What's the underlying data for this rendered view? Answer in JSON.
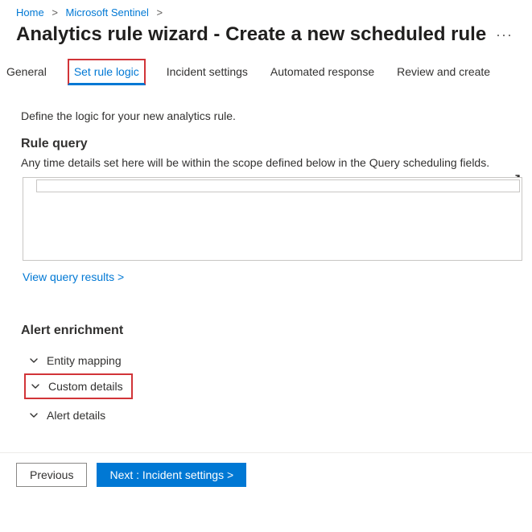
{
  "breadcrumb": {
    "home": "Home",
    "sentinel": "Microsoft Sentinel"
  },
  "title": "Analytics rule wizard - Create a new scheduled rule",
  "ellipsis": "···",
  "tabs": {
    "general": "General",
    "set_rule_logic": "Set rule logic",
    "incident_settings": "Incident settings",
    "automated_response": "Automated response",
    "review_create": "Review and create"
  },
  "intro": "Define the logic for your new analytics rule.",
  "rule_query": {
    "heading": "Rule query",
    "sub": "Any time details set here will be within the scope defined below in the Query scheduling fields.",
    "view_results": "View query results >"
  },
  "enrichment": {
    "heading": "Alert enrichment",
    "entity_mapping": "Entity mapping",
    "custom_details": "Custom details",
    "alert_details": "Alert details"
  },
  "footer": {
    "previous": "Previous",
    "next": "Next : Incident settings >"
  }
}
